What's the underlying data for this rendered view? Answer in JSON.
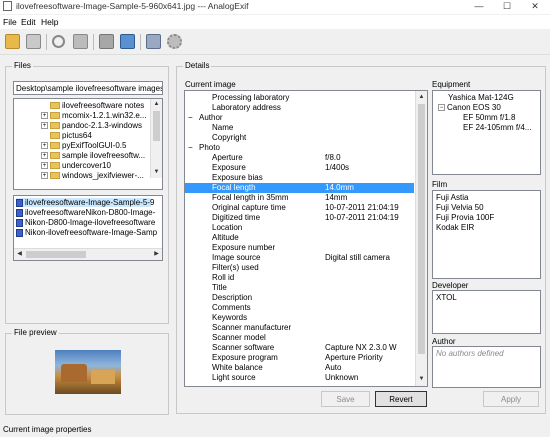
{
  "window": {
    "title": "ilovefreesoftware-Image-Sample-5-960x641.jpg --- AnalogExif",
    "minimize": "—",
    "maximize": "☐",
    "close": "✕"
  },
  "menu": [
    "File",
    "Edit",
    "Help"
  ],
  "toolbar": {
    "icons": [
      "open-folder-icon",
      "save-icon",
      "undo-icon",
      "redo-icon",
      "copy-metadata-icon",
      "next-image-icon",
      "edit-tags-icon",
      "settings-gear-icon"
    ]
  },
  "files": {
    "label": "Files",
    "path": "Desktop\\sample ilovefreesoftware images",
    "tree": [
      {
        "label": "ilovefreesoftware notes",
        "expander": ""
      },
      {
        "label": "mcomix-1.2.1.win32.e...",
        "expander": "+"
      },
      {
        "label": "pandoc-2.1.3-windows",
        "expander": "+"
      },
      {
        "label": "pictus64",
        "expander": ""
      },
      {
        "label": "pyExifToolGUI-0.5",
        "expander": "+"
      },
      {
        "label": "sample ilovefreesoftw...",
        "expander": "+"
      },
      {
        "label": "undercover10",
        "expander": "+"
      },
      {
        "label": "windows_jexifviewer-...",
        "expander": "+"
      }
    ],
    "list": [
      "ilovefreesoftware-Image-Sample-5-9",
      "ilovefreesoftwareNikon-D800-Image-",
      "Nikon-D800-Image-ilovefreesoftware",
      "Nikon-ilovefreesoftware-Image-Samp"
    ]
  },
  "preview": {
    "label": "File preview"
  },
  "details": {
    "label": "Details",
    "current_image_label": "Current image",
    "rows": [
      {
        "name": "Processing laboratory",
        "value": "",
        "level": 2
      },
      {
        "name": "Laboratory address",
        "value": "",
        "level": 2
      },
      {
        "name": "Author",
        "value": "",
        "level": 1,
        "expander": "−"
      },
      {
        "name": "Name",
        "value": "",
        "level": 2
      },
      {
        "name": "Copyright",
        "value": "",
        "level": 2
      },
      {
        "name": "Photo",
        "value": "",
        "level": 1,
        "expander": "−"
      },
      {
        "name": "Aperture",
        "value": "f/8.0",
        "level": 2
      },
      {
        "name": "Exposure",
        "value": "1/400s",
        "level": 2
      },
      {
        "name": "Exposure bias",
        "value": "",
        "level": 2
      },
      {
        "name": "Focal length",
        "value": "14.0mm",
        "level": 2,
        "selected": true
      },
      {
        "name": "Focal length in 35mm",
        "value": "14mm",
        "level": 2
      },
      {
        "name": "Original capture time",
        "value": "10-07-2011 21:04:19",
        "level": 2
      },
      {
        "name": "Digitized time",
        "value": "10-07-2011 21:04:19",
        "level": 2
      },
      {
        "name": "Location",
        "value": "",
        "level": 2
      },
      {
        "name": "Altitude",
        "value": "",
        "level": 2
      },
      {
        "name": "Exposure number",
        "value": "",
        "level": 2
      },
      {
        "name": "Image source",
        "value": "Digital still camera",
        "level": 2
      },
      {
        "name": "Filter(s) used",
        "value": "",
        "level": 2
      },
      {
        "name": "Roll id",
        "value": "",
        "level": 2
      },
      {
        "name": "Title",
        "value": "",
        "level": 2
      },
      {
        "name": "Description",
        "value": "",
        "level": 2
      },
      {
        "name": "Comments",
        "value": "",
        "level": 2
      },
      {
        "name": "Keywords",
        "value": "",
        "level": 2
      },
      {
        "name": "Scanner manufacturer",
        "value": "",
        "level": 2
      },
      {
        "name": "Scanner model",
        "value": "",
        "level": 2
      },
      {
        "name": "Scanner software",
        "value": "Capture NX 2.3.0 W",
        "level": 2
      },
      {
        "name": "Exposure program",
        "value": "Aperture Priority",
        "level": 2
      },
      {
        "name": "White balance",
        "value": "Auto",
        "level": 2
      },
      {
        "name": "Light source",
        "value": "Unknown",
        "level": 2
      }
    ],
    "save_label": "Save",
    "revert_label": "Revert"
  },
  "equipment": {
    "label": "Equipment",
    "items": [
      {
        "label": "Yashica Mat-124G",
        "indent": 1
      },
      {
        "label": "Canon EOS 30",
        "indent": 1,
        "expander": "−"
      },
      {
        "label": "EF 50mm f/1.8",
        "indent": 2
      },
      {
        "label": "EF 24-105mm f/4...",
        "indent": 2
      }
    ]
  },
  "film": {
    "label": "Film",
    "items": [
      "Fuji Astia",
      "Fuji Velvia 50",
      "Fuji Provia 100F",
      "Kodak EIR"
    ]
  },
  "developer": {
    "label": "Developer",
    "items": [
      "XTOL"
    ]
  },
  "author": {
    "label": "Author",
    "placeholder": "No authors defined"
  },
  "apply_label": "Apply",
  "status": "Current image properties"
}
